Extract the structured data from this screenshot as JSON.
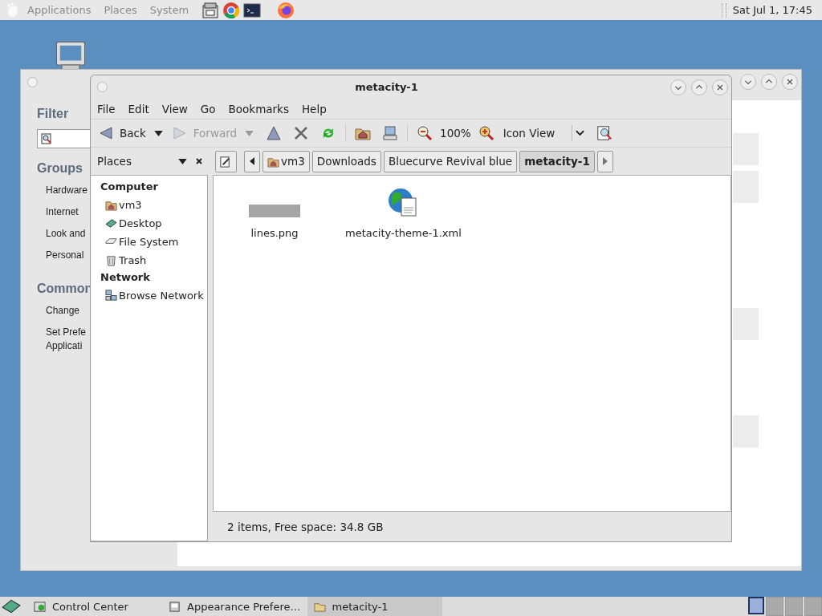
{
  "top_panel": {
    "menus": [
      "Applications",
      "Places",
      "System"
    ],
    "clock": "Sat Jul  1, 17:45"
  },
  "back_window": {
    "filter_heading": "Filter",
    "groups_heading": "Groups",
    "groups": [
      "Hardware",
      "Internet",
      "Look and",
      "Personal"
    ],
    "common_heading": "Common",
    "common": [
      {
        "lines": [
          "Change"
        ]
      },
      {
        "lines": [
          "Set Prefe",
          "Applicati"
        ]
      }
    ]
  },
  "window": {
    "title": "metacity-1",
    "menu": [
      "File",
      "Edit",
      "View",
      "Go",
      "Bookmarks",
      "Help"
    ],
    "toolbar": {
      "back": {
        "label": "Back",
        "disabled": false
      },
      "forward": {
        "label": "Forward",
        "disabled": true
      },
      "zoom": "100%",
      "view": "Icon View"
    },
    "sidebar_header": "Places",
    "path": [
      {
        "label": "vm3",
        "kind": "home",
        "selected": false
      },
      {
        "label": "Downloads",
        "kind": "folder",
        "selected": false
      },
      {
        "label": "Bluecurve Revival blue",
        "kind": "folder",
        "selected": false
      },
      {
        "label": "metacity-1",
        "kind": "folder",
        "selected": true
      }
    ],
    "places": [
      {
        "heading": "Computer",
        "items": [
          {
            "label": "vm3",
            "kind": "home"
          },
          {
            "label": "Desktop",
            "kind": "desktop"
          },
          {
            "label": "File System",
            "kind": "drive"
          },
          {
            "label": "Trash",
            "kind": "trash"
          }
        ]
      },
      {
        "heading": "Network",
        "items": [
          {
            "label": "Browse Network",
            "kind": "network"
          }
        ]
      }
    ],
    "files": [
      {
        "name": "lines.png",
        "kind": "image"
      },
      {
        "name": "metacity-theme-1.xml",
        "kind": "html"
      }
    ],
    "status": "2 items, Free space: 34.8 GB"
  },
  "taskbar": [
    {
      "label": "Control Center",
      "selected": false
    },
    {
      "label": "Appearance Prefere…",
      "selected": false
    },
    {
      "label": "metacity-1",
      "selected": true
    }
  ],
  "workspaces": [
    {
      "selected": true
    },
    {
      "selected": false
    },
    {
      "selected": false
    },
    {
      "selected": false
    }
  ]
}
